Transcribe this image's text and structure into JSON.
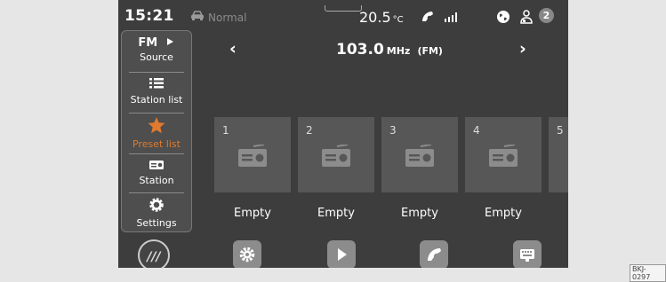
{
  "status": {
    "time": "15:21",
    "drive_mode": "Normal",
    "temperature": "20.5",
    "temperature_unit": "°C",
    "badge_count": "2"
  },
  "menu": {
    "band": "FM",
    "items": [
      {
        "label": "Source",
        "icon": "fm-source-icon"
      },
      {
        "label": "Station list",
        "icon": "list-icon"
      },
      {
        "label": "Preset list",
        "icon": "star-icon",
        "active": true
      },
      {
        "label": "Station",
        "icon": "radio-icon"
      },
      {
        "label": "Settings",
        "icon": "gear-icon"
      }
    ]
  },
  "tuner": {
    "frequency": "103.0",
    "unit": "MHz",
    "band": "(FM)"
  },
  "presets": [
    {
      "number": "1",
      "label": "Empty"
    },
    {
      "number": "2",
      "label": "Empty"
    },
    {
      "number": "3",
      "label": "Empty"
    },
    {
      "number": "4",
      "label": "Empty"
    },
    {
      "number": "5",
      "label": ""
    }
  ],
  "dock": {
    "home_label": "///",
    "buttons": [
      "settings-icon",
      "play-icon",
      "phone-icon",
      "keyboard-icon"
    ]
  },
  "figure_code": "BKJ-0297",
  "colors": {
    "screen_bg": "#3d3d3d",
    "preset_tile": "#575757",
    "accent": "#e07a2e"
  }
}
